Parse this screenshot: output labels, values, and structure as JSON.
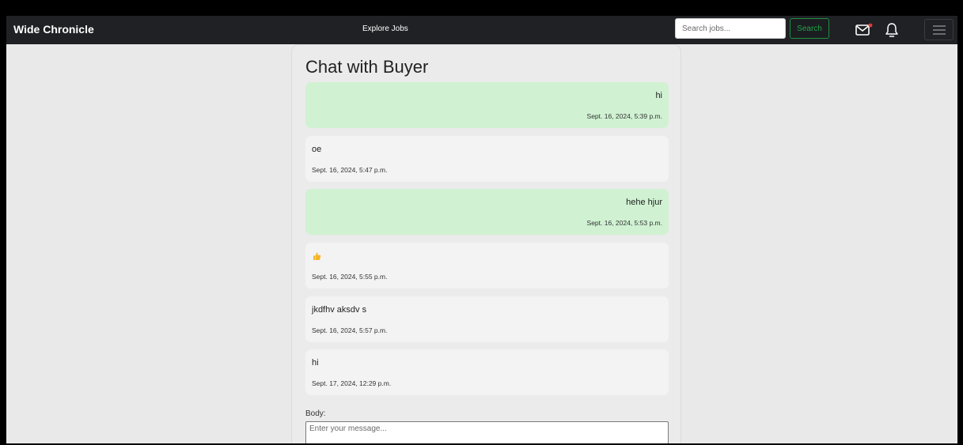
{
  "navbar": {
    "brand": "Wide Chronicle",
    "explore_link": "Explore Jobs",
    "search": {
      "placeholder": "Search jobs...",
      "value": ""
    },
    "search_button": "Search",
    "icons": [
      "mail-icon",
      "notification-dot",
      "bell-icon",
      "hamburger-menu-icon"
    ]
  },
  "chat": {
    "title": "Chat with Buyer",
    "messages": [
      {
        "direction": "sent",
        "text": "hi",
        "time": "Sept. 16, 2024, 5:39 p.m."
      },
      {
        "direction": "received",
        "text": "oe",
        "time": "Sept. 16, 2024, 5:47 p.m."
      },
      {
        "direction": "sent",
        "text": "hehe hjur",
        "time": "Sept. 16, 2024, 5:53 p.m."
      },
      {
        "direction": "received",
        "text": "",
        "emoji": "thumbs-up-icon",
        "time": "Sept. 16, 2024, 5:55 p.m."
      },
      {
        "direction": "received",
        "text": "jkdfhv aksdv s",
        "time": "Sept. 16, 2024, 5:57 p.m."
      },
      {
        "direction": "received",
        "text": "hi",
        "time": "Sept. 17, 2024, 12:29 p.m."
      }
    ],
    "body_label": "Body:",
    "body_placeholder": "Enter your message...",
    "body_value": ""
  },
  "colors": {
    "navbar_bg": "#1f2124",
    "page_bg": "#e9e9e9",
    "sent_bubble": "#d0f2d2",
    "received_bubble": "#f3f3f3",
    "search_button_accent": "#22a24a",
    "notification_dot": "#e53935",
    "thumbs_up": "#f5b428"
  }
}
